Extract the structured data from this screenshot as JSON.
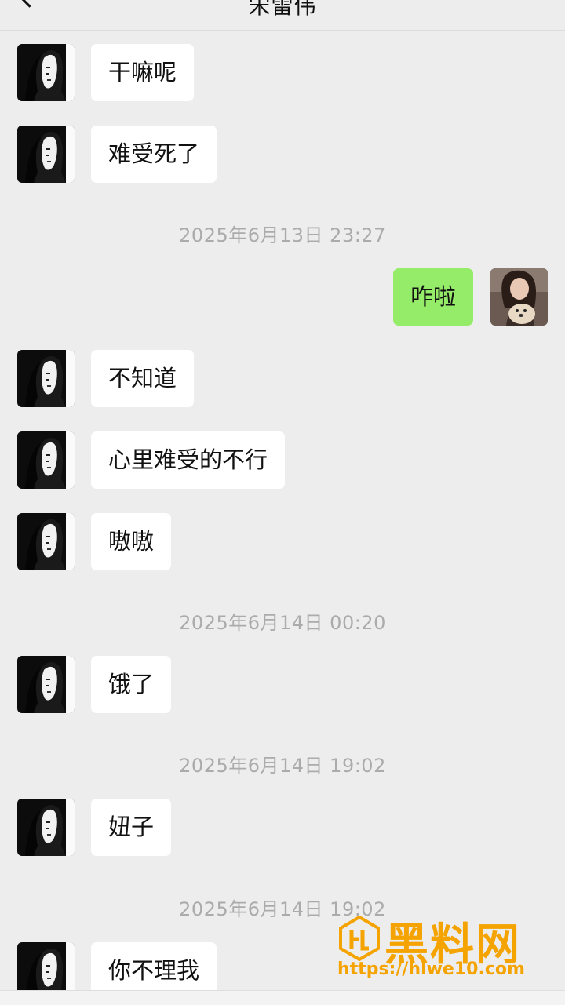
{
  "header": {
    "back_icon": "chevron-left-icon",
    "title": "宋雷伟",
    "more_label": "···"
  },
  "messages": [
    {
      "type": "in",
      "text": "干嘛呢"
    },
    {
      "type": "in",
      "text": "难受死了"
    },
    {
      "type": "time",
      "text": "2025年6月13日 23:27"
    },
    {
      "type": "out",
      "text": "咋啦"
    },
    {
      "type": "in",
      "text": "不知道"
    },
    {
      "type": "in",
      "text": "心里难受的不行"
    },
    {
      "type": "in",
      "text": "嗷嗷"
    },
    {
      "type": "time",
      "text": "2025年6月14日 00:20"
    },
    {
      "type": "in",
      "text": "饿了"
    },
    {
      "type": "time",
      "text": "2025年6月14日 19:02"
    },
    {
      "type": "in",
      "text": "妞子"
    },
    {
      "type": "time",
      "text": "2025年6月14日 19:02"
    },
    {
      "type": "in",
      "text": "你不理我"
    }
  ],
  "watermark": {
    "name": "黑料网",
    "url": "https://hlwe10.com"
  },
  "colors": {
    "background": "#ededed",
    "incoming_bubble": "#ffffff",
    "outgoing_bubble": "#95ec69",
    "timestamp": "#ababab",
    "watermark": "#f5a300"
  }
}
